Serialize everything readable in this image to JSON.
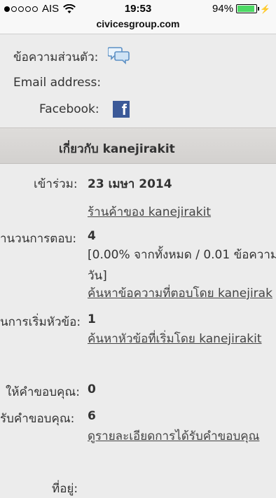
{
  "status_bar": {
    "carrier": "AIS",
    "time": "19:53",
    "battery": "94%",
    "battery_level": 0.94
  },
  "url": "civicesgroup.com",
  "contact": {
    "pm_label": "ข้อความส่วนตัว:",
    "email_label": "Email address:",
    "facebook_label": "Facebook:",
    "facebook_icon_letter": "f"
  },
  "about": {
    "header": "เกี่ยวกับ kanejirakit",
    "joined_label": "เข้าร่วม:",
    "joined_value": "23 เมษา 2014",
    "shop_link": "ร้านค้าของ kanejirakit",
    "posts_label": "านวนการตอบ:",
    "posts_value": "4",
    "posts_stats_line1": "[0.00% จากทั้งหมด / 0.01 ข้อความ",
    "posts_stats_line2": "วัน]",
    "posts_search_link": "ค้นหาข้อความที่ตอบโดย kanejirak",
    "topics_label": "นการเริ่มหัวข้อ:",
    "topics_value": "1",
    "topics_search_link": "ค้นหาหัวข้อที่เริ่มโดย kanejirakit",
    "thanks_given_label": "ให้คำขอบคุณ:",
    "thanks_given_value": "0",
    "thanks_received_label": "รับคำขอบคุณ:",
    "thanks_received_value": "6",
    "thanks_detail_link": "ดูรายละเอียดการได้รับคำขอบคุณ",
    "location_label": "ที่อยู่:"
  },
  "colors": {
    "background": "#ececec",
    "header_bar": "#d8d6d4",
    "facebook_blue": "#3b5998",
    "battery_green": "#4cd964"
  }
}
